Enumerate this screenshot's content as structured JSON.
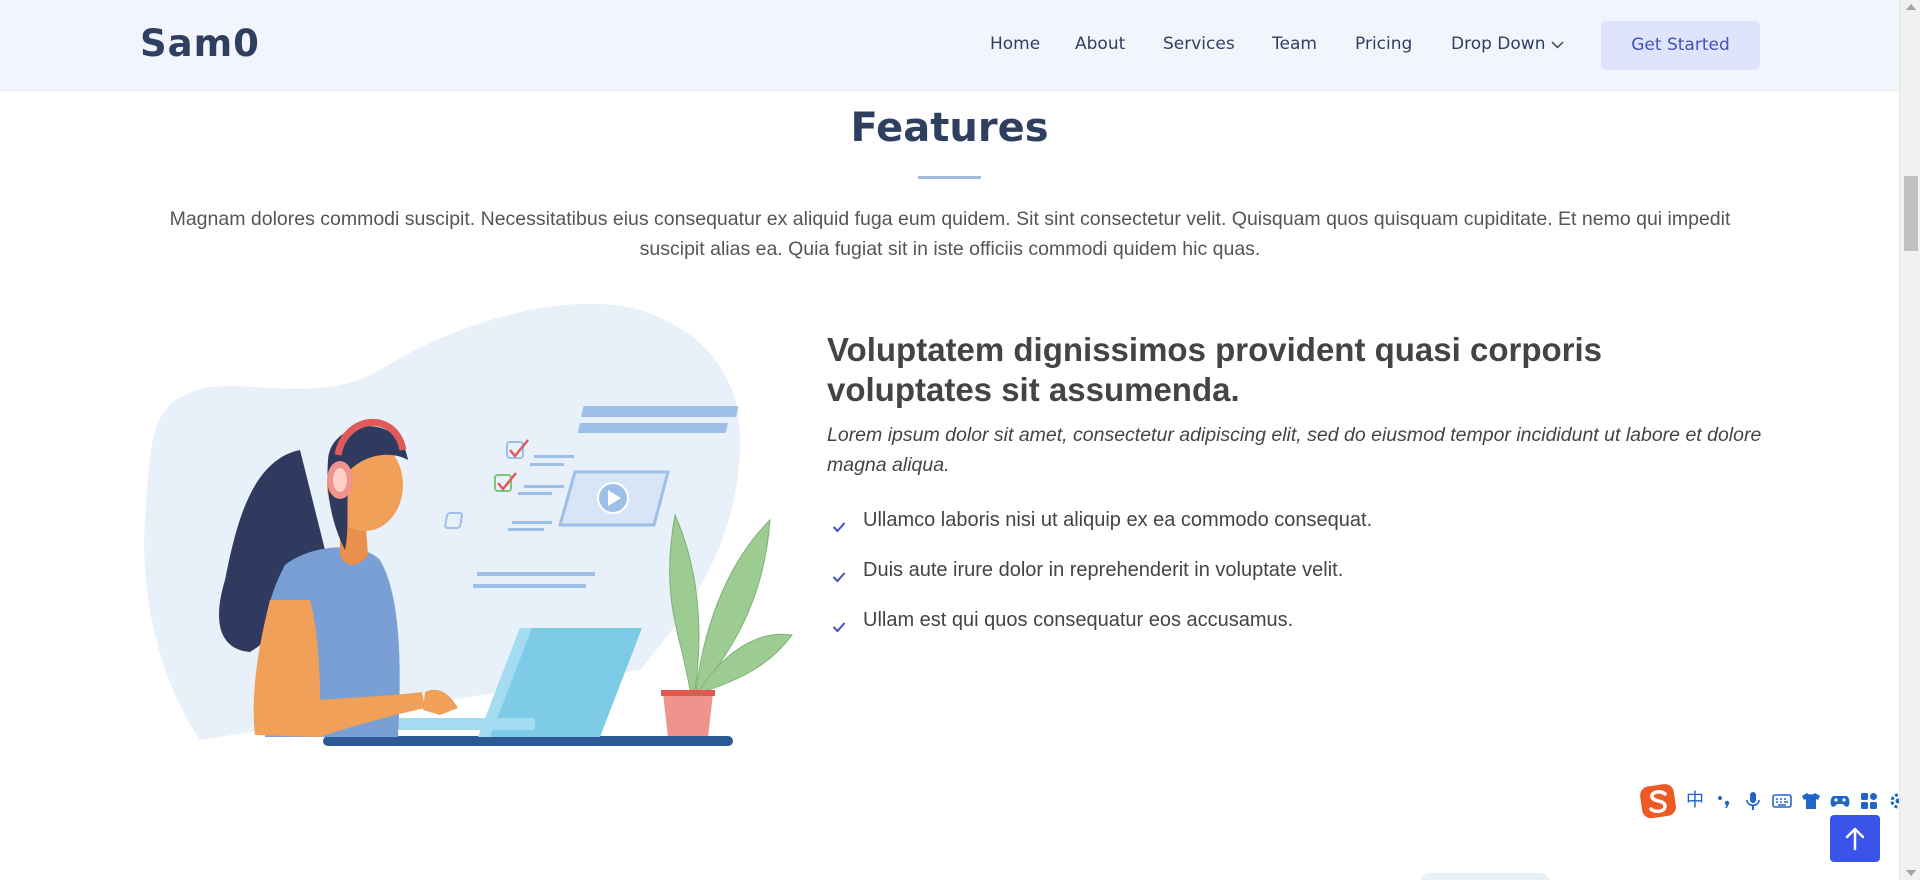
{
  "header": {
    "logo": "Sam0",
    "nav": [
      {
        "label": "Home"
      },
      {
        "label": "About"
      },
      {
        "label": "Services"
      },
      {
        "label": "Team"
      },
      {
        "label": "Pricing"
      },
      {
        "label": "Drop Down"
      }
    ],
    "cta_label": "Get Started"
  },
  "features": {
    "title": "Features",
    "description": "Magnam dolores commodi suscipit. Necessitatibus eius consequatur ex aliquid fuga eum quidem. Sit sint consectetur velit. Quisquam quos quisquam cupiditate. Et nemo qui impedit suscipit alias ea. Quia fugiat sit in iste officiis commodi quidem hic quas.",
    "heading": "Voluptatem dignissimos provident quasi corporis voluptates sit assumenda.",
    "lead": "Lorem ipsum dolor sit amet, consectetur adipiscing elit, sed do eiusmod tempor incididunt ut labore et dolore magna aliqua.",
    "items": [
      "Ullamco laboris nisi ut aliquip ex ea commodo consequat.",
      "Duis aute irure dolor in reprehenderit in voluptate velit.",
      "Ullam est qui quos consequatur eos accusamus."
    ]
  },
  "ime_toolbar": {
    "icons": [
      "sogou-logo-icon",
      "chinese-mode-icon",
      "punctuation-icon",
      "microphone-icon",
      "keyboard-icon",
      "skin-shirt-icon",
      "gamepad-icon",
      "apps-grid-icon",
      "settings-gear-icon"
    ],
    "mode_label": "中"
  },
  "colors": {
    "accent": "#3a53e8",
    "heading": "#2f3f5f",
    "header_bg": "#f3f5fc",
    "cta_bg": "#dfe3fb"
  }
}
